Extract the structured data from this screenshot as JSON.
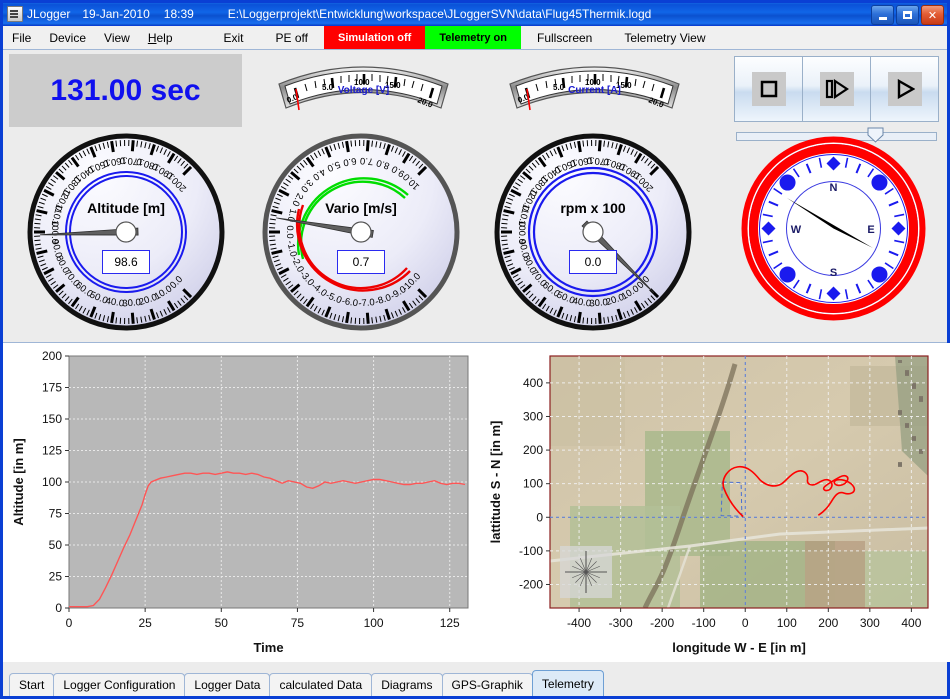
{
  "window": {
    "app_title": "JLogger",
    "date": "19-Jan-2010",
    "time": "18:39",
    "file_path": "E:\\Loggerprojekt\\Entwicklung\\workspace\\JLoggerSVN\\data\\Flug45Thermik.logd",
    "buttons": {
      "minimize": "_",
      "maximize": "□",
      "close": "✕"
    }
  },
  "menu": {
    "items": [
      "File",
      "Device",
      "View",
      "Help"
    ],
    "exit": "Exit",
    "pe": "PE off",
    "simulation": "Simulation off",
    "telemetry": "Telemetry on",
    "fullscreen": "Fullscreen",
    "telemetry_view": "Telemetry View",
    "colors": {
      "simulation_bg": "#ff0000",
      "simulation_fg": "#ffffff",
      "telemetry_bg": "#00ff00",
      "telemetry_fg": "#000000"
    }
  },
  "telemetry": {
    "elapsed": "131.00 sec",
    "elapsed_color": "#1010ee",
    "arc_meters": [
      {
        "label": "Voltage [V]",
        "min": 0.0,
        "max": 20.0,
        "value": 0.3,
        "ticks": [
          "0.0",
          "5.0",
          "10.0",
          "15.0",
          "20.0"
        ],
        "needle_color": "#ff0000"
      },
      {
        "label": "Current [A]",
        "min": 0.0,
        "max": 20.0,
        "value": 0.3,
        "ticks": [
          "0.0",
          "5.0",
          "10.0",
          "15.0",
          "20.0"
        ],
        "needle_color": "#ff0000"
      }
    ],
    "dials": [
      {
        "name": "altitude",
        "title": "Altitude [m]",
        "value": "98.6",
        "numeric": 98.6,
        "min": 0,
        "max": 200,
        "step": 10,
        "ticks": [
          "0.0",
          "10.0",
          "20.0",
          "30.0",
          "40.0",
          "50.0",
          "60.0",
          "70.0",
          "80.0",
          "90.0",
          "100.0",
          "110.0",
          "120.0",
          "130.0",
          "140.0",
          "150.0",
          "160.0",
          "170.0",
          "180.0",
          "190.0",
          "200.0"
        ],
        "ring_color": "#1a1aee",
        "rim_color": "#111111"
      },
      {
        "name": "vario",
        "title": "Vario [m/s]",
        "value": "0.7",
        "numeric": 0.7,
        "min": -10,
        "max": 10,
        "step": 1,
        "ticks": [
          "0.0",
          "1.0",
          "2.0",
          "3.0",
          "4.0",
          "5.0",
          "6.0",
          "7.0",
          "8.0",
          "9.0",
          "10.0",
          "-1.0",
          "-2.0",
          "-3.0",
          "-4.0",
          "-5.0",
          "-6.0",
          "-7.0",
          "-8.0",
          "-9.0",
          "-10.0"
        ],
        "arc_up_color": "#00dd00",
        "arc_down_color": "#ee0000",
        "rim_color": "#555555"
      },
      {
        "name": "rpm",
        "title": "rpm x 100",
        "value": "0.0",
        "numeric": 0.0,
        "min": 0,
        "max": 200,
        "step": 10,
        "ticks": [
          "0.0",
          "10.0",
          "20.0",
          "30.0",
          "40.0",
          "50.0",
          "60.0",
          "70.0",
          "80.0",
          "90.0",
          "100.0",
          "110.0",
          "120.0",
          "130.0",
          "140.0",
          "150.0",
          "160.0",
          "170.0",
          "180.0",
          "190.0",
          "200.0"
        ],
        "ring_color": "#1a1aee",
        "rim_color": "#111111"
      }
    ],
    "compass": {
      "name": "compass",
      "cardinals": [
        "N",
        "E",
        "S",
        "W"
      ],
      "heading_deg": 112,
      "ring_color": "#ff0000",
      "marker_color": "#1a1aee",
      "needle_color": "#000000"
    },
    "playback": {
      "stop_label": "stop",
      "pause_label": "pause",
      "play_label": "play",
      "slider_value": 66
    }
  },
  "chart_data": [
    {
      "type": "line",
      "name": "altitude-over-time",
      "title": "",
      "xlabel": "Time",
      "ylabel": "Altitude [in m]",
      "xlim": [
        0,
        131
      ],
      "ylim": [
        0,
        200
      ],
      "xticks": [
        "0",
        "25",
        "50",
        "75",
        "100",
        "125"
      ],
      "yticks": [
        "0",
        "25",
        "50",
        "75",
        "100",
        "125",
        "150",
        "175",
        "200"
      ],
      "grid": true,
      "plot_bg": "#b8b8b8",
      "line_color": "#ff5555",
      "x": [
        0,
        2,
        4,
        6,
        8,
        10,
        12,
        14,
        16,
        18,
        20,
        22,
        24,
        25,
        26,
        27,
        28,
        30,
        32,
        34,
        36,
        38,
        40,
        42,
        44,
        46,
        48,
        50,
        52,
        54,
        56,
        58,
        60,
        62,
        64,
        66,
        68,
        70,
        72,
        74,
        76,
        78,
        80,
        82,
        84,
        86,
        88,
        90,
        92,
        94,
        96,
        98,
        100,
        102,
        104,
        106,
        108,
        110,
        112,
        114,
        116,
        118,
        120,
        122,
        124,
        126,
        128,
        130
      ],
      "y": [
        1,
        1,
        1,
        1,
        2,
        7,
        16,
        26,
        37,
        48,
        58,
        70,
        82,
        90,
        97,
        100,
        101,
        103,
        104,
        105,
        106,
        107,
        107,
        106,
        107,
        107,
        106,
        107,
        108,
        107,
        107,
        106,
        107,
        106,
        104,
        103,
        101,
        99,
        101,
        100,
        99,
        96,
        95,
        97,
        100,
        99,
        100,
        101,
        100,
        99,
        100,
        101,
        102,
        102,
        101,
        100,
        99,
        98,
        98,
        99,
        99,
        100,
        101,
        99,
        98,
        99,
        99,
        98
      ]
    },
    {
      "type": "scatter",
      "name": "gps-track",
      "title": "",
      "xlabel": "longitude W - E [in m]",
      "ylabel": "lattitude S - N [in m]",
      "xlim": [
        -470,
        440
      ],
      "ylim": [
        -270,
        480
      ],
      "xticks": [
        "-400",
        "-300",
        "-200",
        "-100",
        "0",
        "100",
        "200",
        "300",
        "400"
      ],
      "yticks": [
        "-200",
        "-100",
        "0",
        "100",
        "200",
        "300",
        "400"
      ],
      "grid": true,
      "track_color": "#ff0000",
      "crosshair_color": "#4a6fd0",
      "background": "aerial-photo"
    }
  ],
  "tabs": [
    {
      "label": "Start",
      "active": false
    },
    {
      "label": "Logger Configuration",
      "active": false
    },
    {
      "label": "Logger Data",
      "active": false
    },
    {
      "label": "calculated Data",
      "active": false
    },
    {
      "label": "Diagrams",
      "active": false
    },
    {
      "label": "GPS-Graphik",
      "active": false
    },
    {
      "label": "Telemetry",
      "active": true
    }
  ]
}
